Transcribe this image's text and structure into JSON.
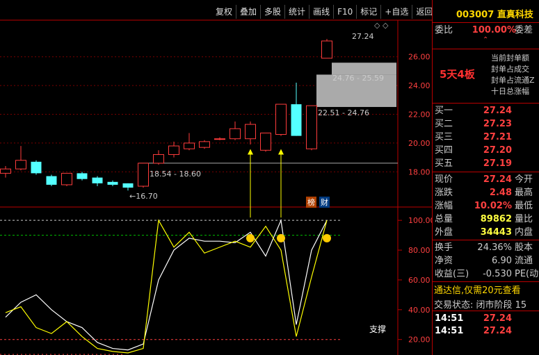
{
  "toolbar": {
    "buttons": [
      "复权",
      "叠加",
      "多股",
      "统计",
      "画线",
      "F10",
      "标记",
      "+自选",
      "返回"
    ]
  },
  "stock": {
    "code": "003007",
    "name": "直真科技",
    "code_color": "#ffd700"
  },
  "weibi": {
    "label": "委比",
    "value": "100.00%",
    "label2": "委差"
  },
  "board_streak": "5天4板",
  "seal_info": [
    "当前封单额",
    "封单占成交",
    "封单占流通Z",
    "十日总涨幅"
  ],
  "sell_orders": [
    {
      "label": "买一",
      "price": "27.24"
    },
    {
      "label": "买二",
      "price": "27.23"
    },
    {
      "label": "买三",
      "price": "27.21"
    },
    {
      "label": "买四",
      "price": "27.20"
    },
    {
      "label": "买五",
      "price": "27.19"
    }
  ],
  "quote": [
    {
      "label": "现价",
      "value": "27.24",
      "label2": "今开"
    },
    {
      "label": "涨跌",
      "value": "2.48",
      "label2": "最高"
    },
    {
      "label": "涨幅",
      "value": "10.02%",
      "label2": "最低"
    },
    {
      "label": "总量",
      "value": "89862",
      "label2": "量比"
    },
    {
      "label": "外盘",
      "value": "34443",
      "label2": "内盘"
    }
  ],
  "quote2": [
    {
      "label": "换手",
      "value": "24.36%",
      "label2": "股本"
    },
    {
      "label": "净资",
      "value": "6.90",
      "label2": "流通"
    },
    {
      "label": "收益(三)",
      "value": "-0.530",
      "label2": "PE(动"
    }
  ],
  "ad_text": "通达信,仅需20元查看",
  "trade_status": "交易状态: 闭市阶段 15",
  "ticks": [
    {
      "time": "14:51",
      "price": "27.24"
    },
    {
      "time": "14:51",
      "price": "27.24"
    }
  ],
  "chart_labels": {
    "last_price": "27.24",
    "range_high": "24.76 - 25.59",
    "range_mid": "22.51 - 24.76",
    "range_low": "18.54 - 18.60",
    "low_marker": "16.70",
    "tag_bang": "榜",
    "tag_cai": "财",
    "support": "支撑"
  },
  "chart_data": {
    "type": "candlestick",
    "ylim": [
      15.6,
      28.5
    ],
    "price_ticks": [
      "26.00",
      "24.00",
      "22.00",
      "20.00",
      "18.00"
    ],
    "candles": [
      {
        "o": 18.2,
        "c": 17.9,
        "h": 18.4,
        "l": 17.6,
        "up": true
      },
      {
        "o": 18.2,
        "c": 18.8,
        "h": 19.8,
        "l": 18.1,
        "up": true
      },
      {
        "o": 18.7,
        "c": 17.9,
        "h": 18.8,
        "l": 17.8,
        "up": false
      },
      {
        "o": 17.7,
        "c": 17.1,
        "h": 17.8,
        "l": 17.0,
        "up": false
      },
      {
        "o": 17.1,
        "c": 17.9,
        "h": 17.9,
        "l": 17.0,
        "up": true
      },
      {
        "o": 17.9,
        "c": 17.5,
        "h": 18.0,
        "l": 17.4,
        "up": false
      },
      {
        "o": 17.6,
        "c": 17.2,
        "h": 17.7,
        "l": 17.0,
        "up": false
      },
      {
        "o": 17.3,
        "c": 17.1,
        "h": 17.4,
        "l": 17.0,
        "up": false
      },
      {
        "o": 17.2,
        "c": 16.9,
        "h": 17.2,
        "l": 16.7,
        "up": false
      },
      {
        "o": 17.0,
        "c": 18.6,
        "h": 18.6,
        "l": 16.9,
        "up": true
      },
      {
        "o": 18.6,
        "c": 19.2,
        "h": 19.5,
        "l": 18.5,
        "up": true
      },
      {
        "o": 19.2,
        "c": 19.8,
        "h": 20.1,
        "l": 19.0,
        "up": true
      },
      {
        "o": 19.6,
        "c": 20.0,
        "h": 20.7,
        "l": 19.5,
        "up": true
      },
      {
        "o": 19.7,
        "c": 20.1,
        "h": 20.2,
        "l": 19.6,
        "up": true
      },
      {
        "o": 20.3,
        "c": 20.3,
        "h": 20.4,
        "l": 20.2,
        "up": true
      },
      {
        "o": 20.3,
        "c": 21.0,
        "h": 21.5,
        "l": 20.2,
        "up": true
      },
      {
        "o": 20.3,
        "c": 21.3,
        "h": 21.5,
        "l": 19.9,
        "up": true
      },
      {
        "o": 19.5,
        "c": 20.7,
        "h": 20.7,
        "l": 19.4,
        "up": true
      },
      {
        "o": 20.6,
        "c": 22.7,
        "h": 22.7,
        "l": 20.5,
        "up": true
      },
      {
        "o": 22.7,
        "c": 20.5,
        "h": 24.2,
        "l": 20.5,
        "up": false
      },
      {
        "o": 19.6,
        "c": 22.6,
        "h": 22.6,
        "l": 19.5,
        "up": true
      },
      {
        "o": 25.9,
        "c": 27.1,
        "h": 27.24,
        "l": 25.9,
        "up": true
      }
    ],
    "indicator": {
      "type": "line",
      "ylim": [
        11,
        108
      ],
      "y_ticks": [
        "100.00",
        "80.00",
        "60.00",
        "40.00",
        "20.00"
      ],
      "white": [
        35,
        45,
        50,
        40,
        32,
        28,
        18,
        14,
        13,
        17,
        60,
        80,
        88,
        86,
        86,
        85,
        92,
        76,
        100,
        30,
        80,
        100
      ],
      "yellow": [
        38,
        42,
        28,
        24,
        32,
        22,
        14,
        12,
        11,
        14,
        100,
        82,
        92,
        78,
        82,
        86,
        82,
        96,
        80,
        22,
        62,
        100
      ],
      "smiley_indices": [
        16,
        18,
        21
      ]
    }
  }
}
